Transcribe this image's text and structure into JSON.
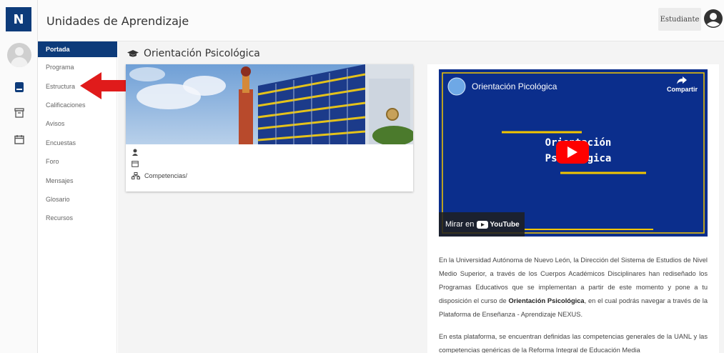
{
  "app": {
    "logo_letter": "N",
    "header_title": "Unidades de Aprendizaje",
    "user_role": "Estudiante"
  },
  "menu": {
    "items": [
      {
        "label": "Portada",
        "active": true
      },
      {
        "label": "Programa"
      },
      {
        "label": "Estructura"
      },
      {
        "label": "Calificaciones"
      },
      {
        "label": "Avisos"
      },
      {
        "label": "Encuestas"
      },
      {
        "label": "Foro"
      },
      {
        "label": "Mensajes"
      },
      {
        "label": "Glosario"
      },
      {
        "label": "Recursos"
      }
    ]
  },
  "rail": {
    "icons": [
      "book-icon",
      "archive-icon",
      "calendar-icon"
    ]
  },
  "main": {
    "section_title": "Orientación Psicológica",
    "card": {
      "competencias_label": "Competencias/"
    },
    "video": {
      "title": "Orientación Picológica",
      "share_label": "Compartir",
      "overlay_line1": "Orientación",
      "overlay_line2": "Psicológica",
      "watch_label": "Mirar en",
      "youtube_label": "YouTube"
    },
    "paragraph1": {
      "before": "En la Universidad Autónoma de Nuevo León, la Dirección del Sistema de Estudios de Nivel Medio Superior, a través de los Cuerpos Académicos Disciplinares han rediseñado los Programas Educativos que se implementan a partir de este momento y pone a tu disposición el curso de ",
      "bold": "Orientación Psicológica",
      "after": ", en el cual podrás navegar a través de la Plataforma de Enseñanza - Aprendizaje NEXUS."
    },
    "paragraph2": "En esta plataforma, se encuentran definidas las competencias generales de la UANL y las competencias genéricas de la Reforma Integral de Educación Media"
  },
  "colors": {
    "brand": "#0d3b7a",
    "annotation_arrow": "#e01b1b",
    "video_bg": "#0b2e8c",
    "video_accent": "#f2c500"
  }
}
